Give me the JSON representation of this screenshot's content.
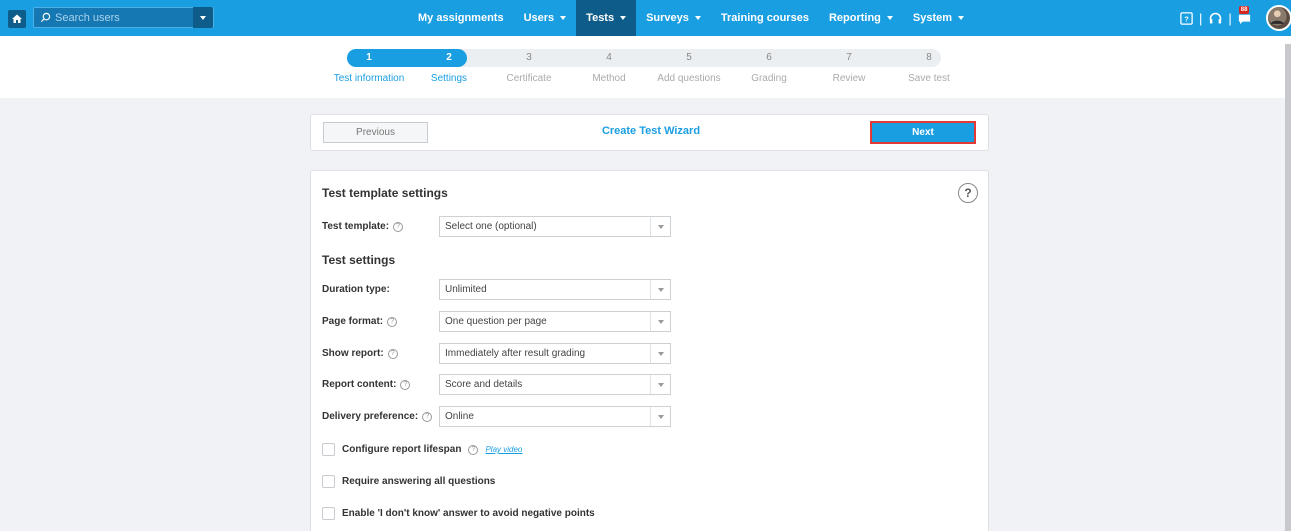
{
  "topbar": {
    "search_placeholder": "Search users",
    "nav": [
      {
        "label": "My assignments",
        "has_caret": false
      },
      {
        "label": "Users",
        "has_caret": true
      },
      {
        "label": "Tests",
        "has_caret": true,
        "active": true
      },
      {
        "label": "Surveys",
        "has_caret": true
      },
      {
        "label": "Training courses",
        "has_caret": false
      },
      {
        "label": "Reporting",
        "has_caret": true
      },
      {
        "label": "System",
        "has_caret": true
      }
    ],
    "notification_count": "88"
  },
  "stepper": {
    "steps": [
      {
        "num": "1",
        "label": "Test information",
        "done": true
      },
      {
        "num": "2",
        "label": "Settings",
        "done": true
      },
      {
        "num": "3",
        "label": "Certificate",
        "done": false
      },
      {
        "num": "4",
        "label": "Method",
        "done": false
      },
      {
        "num": "5",
        "label": "Add questions",
        "done": false
      },
      {
        "num": "6",
        "label": "Grading",
        "done": false
      },
      {
        "num": "7",
        "label": "Review",
        "done": false
      },
      {
        "num": "8",
        "label": "Save test",
        "done": false
      }
    ]
  },
  "wizard": {
    "previous_label": "Previous",
    "title": "Create Test Wizard",
    "next_label": "Next"
  },
  "panel": {
    "template_section_title": "Test template settings",
    "help_label": "?",
    "test_template_label": "Test template:",
    "test_template_value": "Select one (optional)",
    "settings_section_title": "Test settings",
    "duration_type_label": "Duration type:",
    "duration_type_value": "Unlimited",
    "page_format_label": "Page format:",
    "page_format_value": "One question per page",
    "show_report_label": "Show report:",
    "show_report_value": "Immediately after result grading",
    "report_content_label": "Report content:",
    "report_content_value": "Score and details",
    "delivery_pref_label": "Delivery preference:",
    "delivery_pref_value": "Online",
    "configure_lifespan_label": "Configure report lifespan",
    "play_video_label": "Play video",
    "require_all_label": "Require answering all questions",
    "dont_know_label": "Enable 'I don't know' answer to avoid negative points"
  }
}
